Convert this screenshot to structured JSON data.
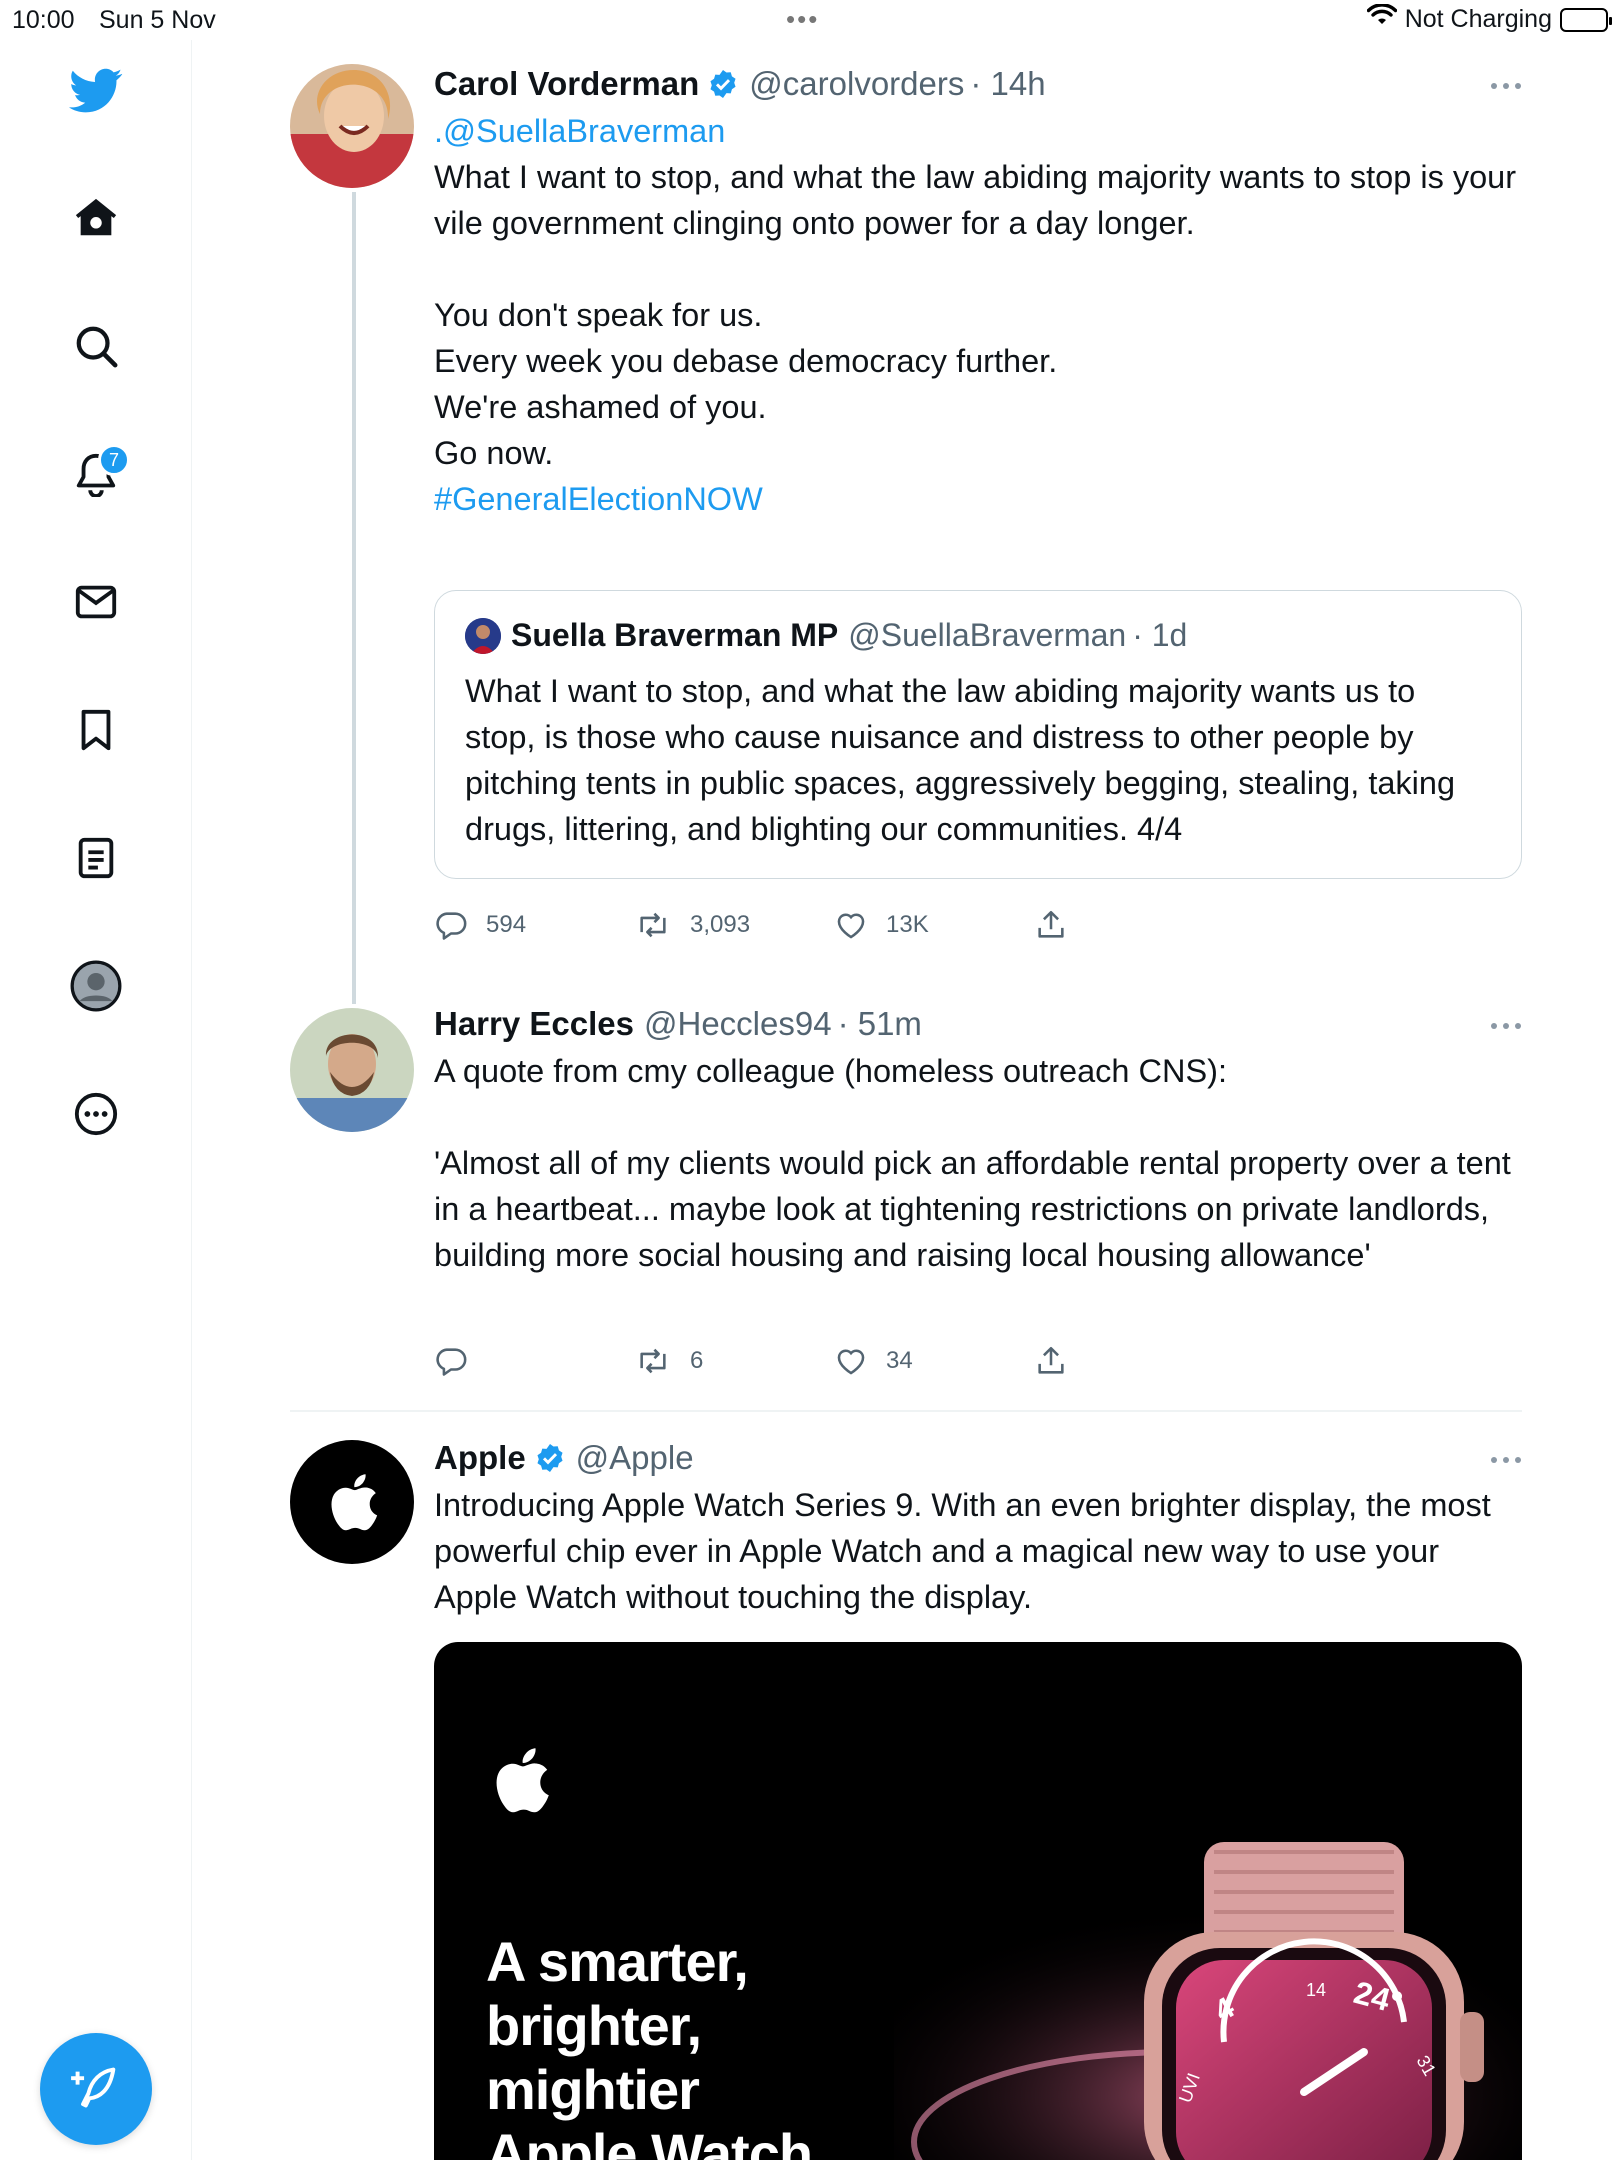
{
  "status_bar": {
    "time": "10:00",
    "date": "Sun 5 Nov",
    "dots": "•••",
    "battery_label": "Not Charging"
  },
  "sidebar": {
    "notifications_badge": "7",
    "accent_color": "#1d9bf0"
  },
  "tweets": [
    {
      "name": "Carol Vorderman",
      "handle": "@carolvorders",
      "time": "· 14h",
      "mention": ".@SuellaBraverman",
      "text": "What I want to stop, and what the law abiding majority wants to stop is your vile government clinging onto power for a day longer.\n\nYou don't speak for us.\nEvery week you debase democracy further.\nWe're ashamed of you.\nGo now.\n",
      "hashtag": "#GeneralElectionNOW",
      "quote": {
        "name": "Suella Braverman MP",
        "handle": "@SuellaBraverman",
        "time": "· 1d",
        "text": "What I want to stop, and what the law abiding majority wants us to stop, is those who cause nuisance and distress to other people by pitching tents in public spaces, aggressively begging, stealing, taking drugs, littering, and blighting our communities. 4/4"
      },
      "replies": "594",
      "retweets": "3,093",
      "likes": "13K"
    },
    {
      "name": "Harry Eccles",
      "handle": "@Heccles94",
      "time": "· 51m",
      "text": "A quote from cmy colleague (homeless outreach CNS):\n\n'Almost all of my clients would pick an affordable rental property over a tent in a heartbeat... maybe look at tightening restrictions on private landlords, building more social housing and raising local housing allowance'",
      "replies": "",
      "retweets": "6",
      "likes": "34"
    },
    {
      "name": "Apple",
      "handle": "@Apple",
      "text": "Introducing Apple Watch Series 9. With an even brighter display, the most powerful chip ever in Apple Watch and a magical new way to use your Apple Watch without touching the display.",
      "media": {
        "headline_1": "A smarter,",
        "headline_2": "brighter,",
        "headline_3": "mightier",
        "headline_4": "Apple Watch",
        "watch_complication_1": "4",
        "watch_complication_2": "14",
        "watch_complication_3": "24°",
        "watch_complication_4": "UVI",
        "watch_complication_5": "31"
      }
    }
  ]
}
